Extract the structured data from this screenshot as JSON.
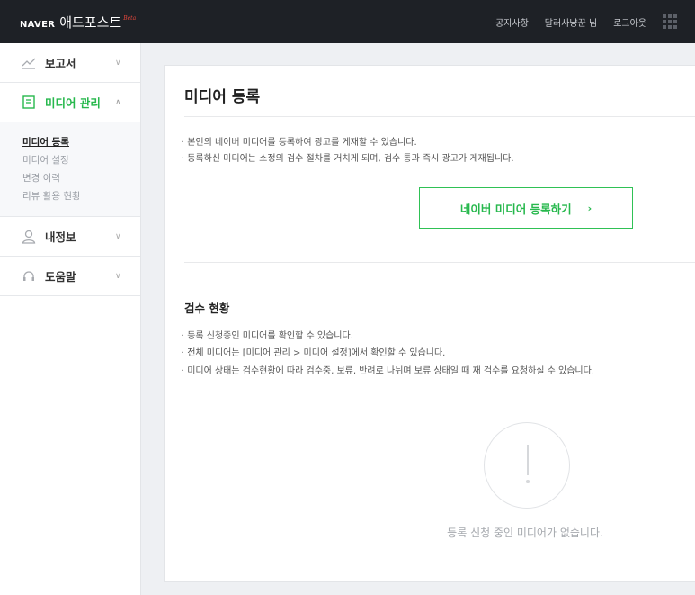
{
  "header": {
    "brand_naver": "NAVER",
    "brand_name": "애드포스트",
    "brand_beta": "Beta",
    "links": [
      "공지사항",
      "달러사냥꾼 님",
      "로그아웃"
    ],
    "apps_icon": "grid-apps-icon"
  },
  "sidebar": {
    "menus": [
      {
        "label": "보고서",
        "icon": "chart-line-icon",
        "expanded": false
      },
      {
        "label": "미디어 관리",
        "icon": "document-icon",
        "expanded": true
      },
      {
        "label": "내정보",
        "icon": "person-icon",
        "expanded": false
      },
      {
        "label": "도움말",
        "icon": "headset-icon",
        "expanded": false
      }
    ],
    "submenu": [
      "미디어 등록",
      "미디어 설정",
      "변경 이력",
      "리뷰 활용 현황"
    ],
    "active_color": "#27b84d"
  },
  "main": {
    "title": "미디어 등록",
    "intro": [
      "본인의 네이버 미디어를 등록하여 광고를 게재할 수 있습니다.",
      "등록하신 미디어는 소정의 검수 절차를 거치게 되며, 검수 통과 즉시 광고가 게재됩니다."
    ],
    "register_button": "네이버 미디어 등록하기",
    "register_arrow": "›",
    "review_title": "검수 현황",
    "review_notes": [
      "등록 신청중인 미디어를 확인할 수 있습니다.",
      "전체 미디어는 [미디어 관리 > 미디어 설정]에서 확인할 수 있습니다.",
      "미디어 상태는 검수현황에 따라 검수중, 보류, 반려로 나뉘며 보류 상태일 때 재 검수를 요청하실 수 있습니다."
    ],
    "empty_icon": "exclamation-circle-icon",
    "empty_message": "등록 신청 중인 미디어가 없습니다."
  }
}
